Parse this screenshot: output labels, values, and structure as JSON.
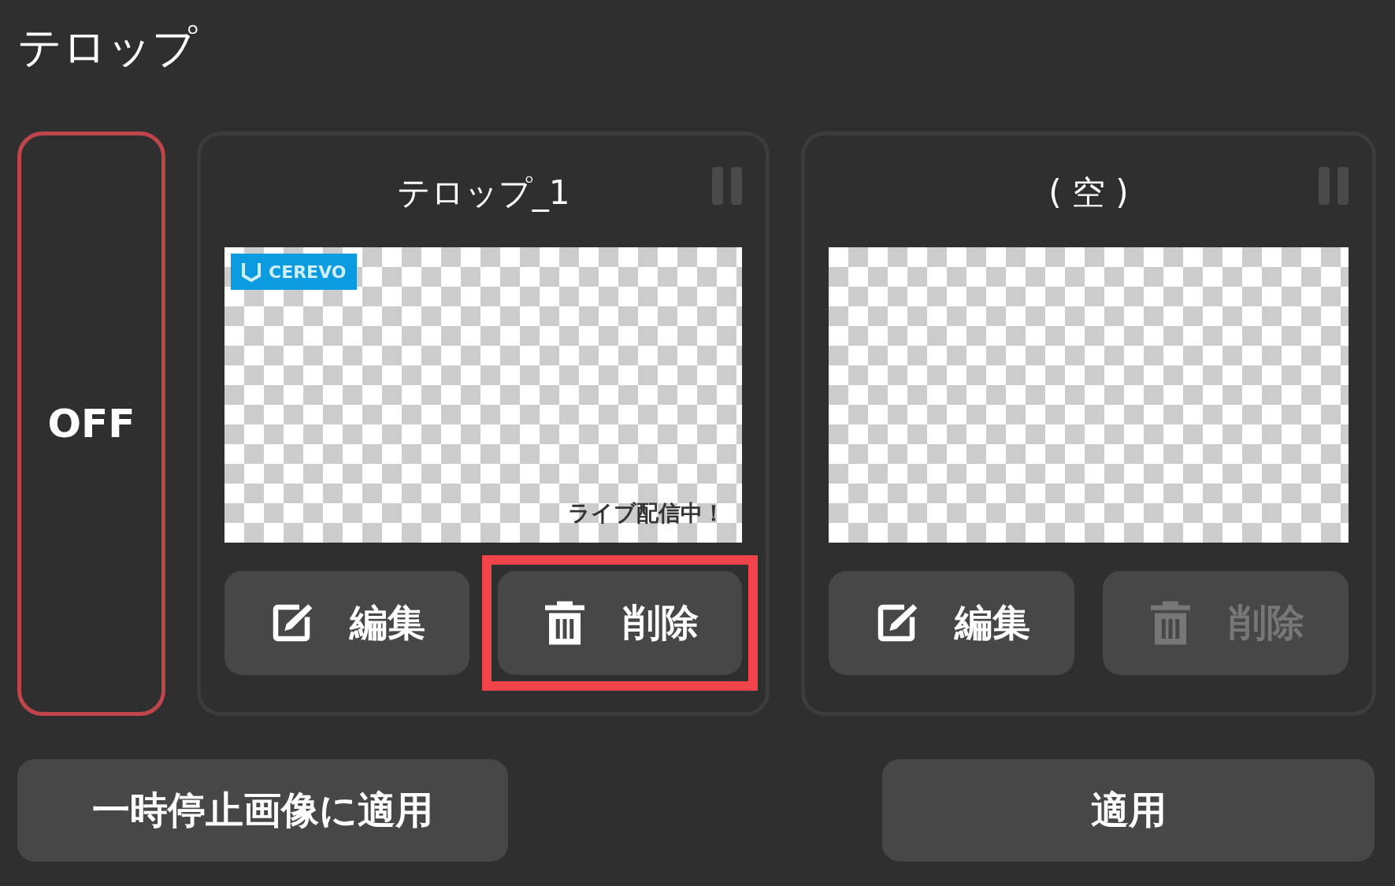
{
  "title": "テロップ",
  "toggle": {
    "label": "OFF",
    "on": false
  },
  "slots": [
    {
      "name": "テロップ_1",
      "preview": {
        "logo": "CEREVO",
        "caption": "ライブ配信中！"
      },
      "buttons": [
        {
          "kind": "edit",
          "label": "編集",
          "disabled": false,
          "highlighted": false
        },
        {
          "kind": "delete",
          "label": "削除",
          "disabled": false,
          "highlighted": true
        }
      ]
    },
    {
      "name": "( 空 )",
      "buttons": [
        {
          "kind": "edit",
          "label": "編集",
          "disabled": false,
          "highlighted": false
        },
        {
          "kind": "delete",
          "label": "削除",
          "disabled": true,
          "highlighted": false
        }
      ]
    }
  ],
  "footer": [
    {
      "label": "一時停止画像に適用"
    },
    {
      "label": "適用"
    }
  ]
}
